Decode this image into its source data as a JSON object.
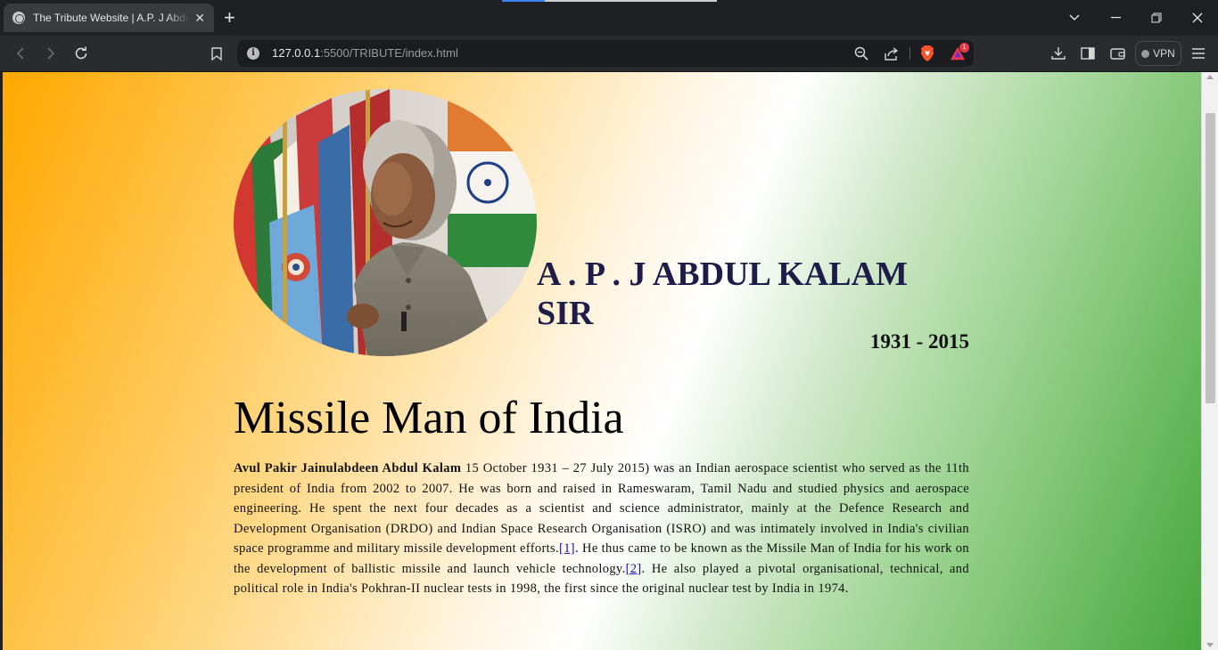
{
  "browser": {
    "tab_title": "The Tribute Website | A.P. J Abdul Kalam",
    "url_host": "127.0.0.1",
    "url_rest": ":5500/TRIBUTE/index.html",
    "vpn_label": "VPN",
    "brave_badge": "1"
  },
  "page": {
    "name": "A . P . J ABDUL KALAM SIR",
    "years": "1931 - 2015",
    "heading": "Missile Man of India",
    "bio": {
      "bold_name": "Avul Pakir Jainulabdeen Abdul Kalam",
      "text1": " 15 October 1931 – 27 July 2015) was an Indian aerospace scientist who served as the 11th president of India from 2002 to 2007. He was born and raised in Rameswaram, Tamil Nadu and studied physics and aerospace engineering. He spent the next four decades as a scientist and science administrator, mainly at the Defence Research and Development Organisation (DRDO) and Indian Space Research Organisation (ISRO) and was intimately involved in India's civilian space programme and military missile development efforts.",
      "ref1": "[1]",
      "text2": ". He thus came to be known as the Missile Man of India for his work on the development of ballistic missile and launch vehicle technology.",
      "ref2": "[2]",
      "text3": ". He also played a pivotal organisational, technical, and political role in India's Pokhran-II nuclear tests in 1998, the first since the original nuclear test by India in 1974."
    }
  },
  "colors": {
    "gradient_saffron": "#ffa800",
    "gradient_white": "#ffffff",
    "gradient_green": "#46a63e",
    "name_color": "#1e1d4a",
    "link_color": "#1a0dab"
  },
  "icons": [
    "globe-icon",
    "close-icon",
    "plus-icon",
    "chevron-down-icon",
    "minimize-icon",
    "restore-icon",
    "window-close-icon",
    "back-icon",
    "forward-icon",
    "reload-icon",
    "bookmark-icon",
    "info-icon",
    "zoom-icon",
    "share-icon",
    "brave-shield-icon",
    "brave-rewards-icon",
    "download-icon",
    "sidebar-icon",
    "wallet-icon",
    "menu-icon"
  ]
}
